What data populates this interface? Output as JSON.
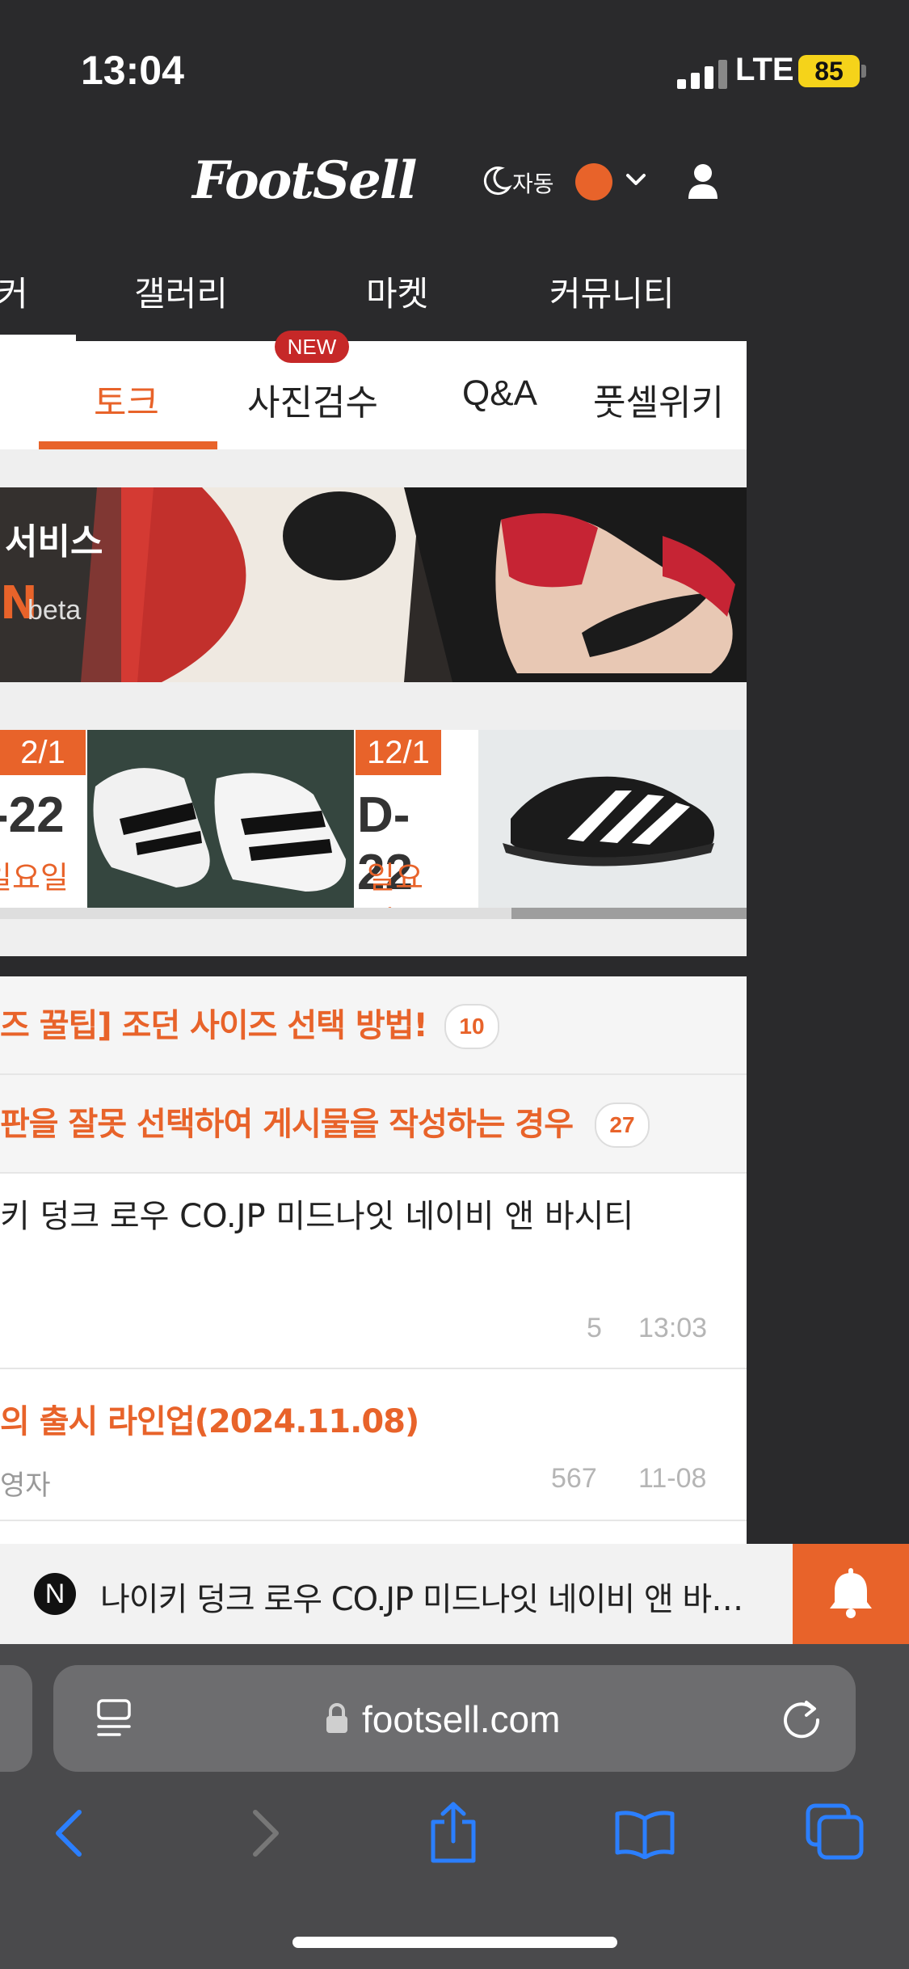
{
  "status_bar": {
    "time": "13:04",
    "network": "LTE",
    "battery": "85"
  },
  "header": {
    "logo": "FootSell",
    "theme_label": "자동",
    "theme_color": "#e8632a"
  },
  "nav": {
    "items": [
      "커",
      "갤러리",
      "마켓",
      "커뮤니티"
    ]
  },
  "subtabs": {
    "items": [
      "토크",
      "사진검수",
      "Q&A",
      "풋셀위키"
    ],
    "new_badge": "NEW",
    "active": "토크"
  },
  "banner": {
    "line1": "서비스",
    "line2": "N",
    "line3": "beta"
  },
  "releases": [
    {
      "date": "2/1",
      "dday": "-22",
      "dow": "일요일"
    },
    {
      "date": "12/1",
      "dday": "D-22",
      "dow": "일요일"
    }
  ],
  "posts": {
    "notices": [
      {
        "title": "즈 꿀팁] 조던 사이즈 선택 방법!",
        "count": "10"
      },
      {
        "title": "판을 잘못 선택하여 게시물을 작성하는 경우",
        "count": "27"
      }
    ],
    "items": [
      {
        "title": "키 덩크 로우 CO.JP 미드나잇 네이비 앤 바시티",
        "views": "5",
        "time": "13:03"
      },
      {
        "title": "의 출시 라인업(2024.11.08)",
        "author": "영자",
        "views": "567",
        "time": "11-08"
      }
    ]
  },
  "notification": {
    "icon_letter": "N",
    "text": "나이키 덩크 로우 CO.JP 미드나잇 네이비 앤 바시티"
  },
  "browser": {
    "url": "footsell.com"
  },
  "colors": {
    "accent": "#e8632a",
    "ios_blue": "#2b7fff"
  }
}
